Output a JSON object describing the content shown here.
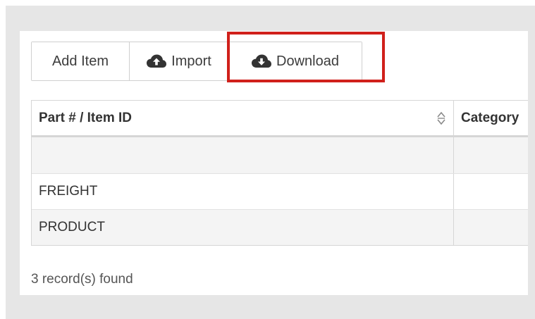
{
  "toolbar": {
    "add_item_label": "Add Item",
    "import_label": "Import",
    "download_label": "Download",
    "import_icon": "cloud-upload-icon",
    "download_icon": "cloud-download-icon"
  },
  "table": {
    "columns": [
      "Part # / Item ID",
      "Category"
    ],
    "rows": [
      [
        "",
        ""
      ],
      [
        "FREIGHT",
        ""
      ],
      [
        "PRODUCT",
        ""
      ]
    ]
  },
  "footer": {
    "records_text": "3 record(s) found"
  },
  "colors": {
    "highlight": "#d0201b",
    "frame_bg": "#e6e6e6"
  }
}
